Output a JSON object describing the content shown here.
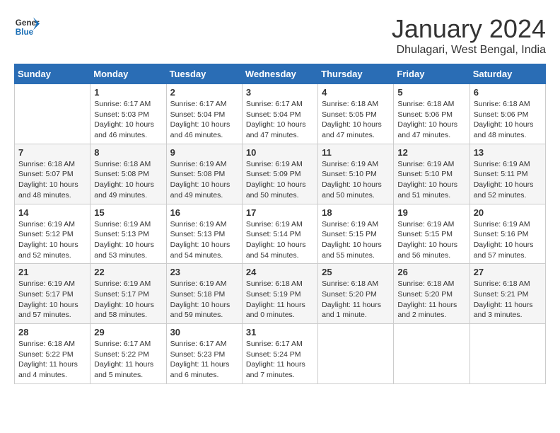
{
  "logo": {
    "line1": "General",
    "line2": "Blue"
  },
  "title": "January 2024",
  "subtitle": "Dhulagari, West Bengal, India",
  "days_of_week": [
    "Sunday",
    "Monday",
    "Tuesday",
    "Wednesday",
    "Thursday",
    "Friday",
    "Saturday"
  ],
  "weeks": [
    [
      {
        "day": "",
        "content": ""
      },
      {
        "day": "1",
        "content": "Sunrise: 6:17 AM\nSunset: 5:03 PM\nDaylight: 10 hours\nand 46 minutes."
      },
      {
        "day": "2",
        "content": "Sunrise: 6:17 AM\nSunset: 5:04 PM\nDaylight: 10 hours\nand 46 minutes."
      },
      {
        "day": "3",
        "content": "Sunrise: 6:17 AM\nSunset: 5:04 PM\nDaylight: 10 hours\nand 47 minutes."
      },
      {
        "day": "4",
        "content": "Sunrise: 6:18 AM\nSunset: 5:05 PM\nDaylight: 10 hours\nand 47 minutes."
      },
      {
        "day": "5",
        "content": "Sunrise: 6:18 AM\nSunset: 5:06 PM\nDaylight: 10 hours\nand 47 minutes."
      },
      {
        "day": "6",
        "content": "Sunrise: 6:18 AM\nSunset: 5:06 PM\nDaylight: 10 hours\nand 48 minutes."
      }
    ],
    [
      {
        "day": "7",
        "content": "Sunrise: 6:18 AM\nSunset: 5:07 PM\nDaylight: 10 hours\nand 48 minutes."
      },
      {
        "day": "8",
        "content": "Sunrise: 6:18 AM\nSunset: 5:08 PM\nDaylight: 10 hours\nand 49 minutes."
      },
      {
        "day": "9",
        "content": "Sunrise: 6:19 AM\nSunset: 5:08 PM\nDaylight: 10 hours\nand 49 minutes."
      },
      {
        "day": "10",
        "content": "Sunrise: 6:19 AM\nSunset: 5:09 PM\nDaylight: 10 hours\nand 50 minutes."
      },
      {
        "day": "11",
        "content": "Sunrise: 6:19 AM\nSunset: 5:10 PM\nDaylight: 10 hours\nand 50 minutes."
      },
      {
        "day": "12",
        "content": "Sunrise: 6:19 AM\nSunset: 5:10 PM\nDaylight: 10 hours\nand 51 minutes."
      },
      {
        "day": "13",
        "content": "Sunrise: 6:19 AM\nSunset: 5:11 PM\nDaylight: 10 hours\nand 52 minutes."
      }
    ],
    [
      {
        "day": "14",
        "content": "Sunrise: 6:19 AM\nSunset: 5:12 PM\nDaylight: 10 hours\nand 52 minutes."
      },
      {
        "day": "15",
        "content": "Sunrise: 6:19 AM\nSunset: 5:13 PM\nDaylight: 10 hours\nand 53 minutes."
      },
      {
        "day": "16",
        "content": "Sunrise: 6:19 AM\nSunset: 5:13 PM\nDaylight: 10 hours\nand 54 minutes."
      },
      {
        "day": "17",
        "content": "Sunrise: 6:19 AM\nSunset: 5:14 PM\nDaylight: 10 hours\nand 54 minutes."
      },
      {
        "day": "18",
        "content": "Sunrise: 6:19 AM\nSunset: 5:15 PM\nDaylight: 10 hours\nand 55 minutes."
      },
      {
        "day": "19",
        "content": "Sunrise: 6:19 AM\nSunset: 5:15 PM\nDaylight: 10 hours\nand 56 minutes."
      },
      {
        "day": "20",
        "content": "Sunrise: 6:19 AM\nSunset: 5:16 PM\nDaylight: 10 hours\nand 57 minutes."
      }
    ],
    [
      {
        "day": "21",
        "content": "Sunrise: 6:19 AM\nSunset: 5:17 PM\nDaylight: 10 hours\nand 57 minutes."
      },
      {
        "day": "22",
        "content": "Sunrise: 6:19 AM\nSunset: 5:17 PM\nDaylight: 10 hours\nand 58 minutes."
      },
      {
        "day": "23",
        "content": "Sunrise: 6:19 AM\nSunset: 5:18 PM\nDaylight: 10 hours\nand 59 minutes."
      },
      {
        "day": "24",
        "content": "Sunrise: 6:18 AM\nSunset: 5:19 PM\nDaylight: 11 hours\nand 0 minutes."
      },
      {
        "day": "25",
        "content": "Sunrise: 6:18 AM\nSunset: 5:20 PM\nDaylight: 11 hours\nand 1 minute."
      },
      {
        "day": "26",
        "content": "Sunrise: 6:18 AM\nSunset: 5:20 PM\nDaylight: 11 hours\nand 2 minutes."
      },
      {
        "day": "27",
        "content": "Sunrise: 6:18 AM\nSunset: 5:21 PM\nDaylight: 11 hours\nand 3 minutes."
      }
    ],
    [
      {
        "day": "28",
        "content": "Sunrise: 6:18 AM\nSunset: 5:22 PM\nDaylight: 11 hours\nand 4 minutes."
      },
      {
        "day": "29",
        "content": "Sunrise: 6:17 AM\nSunset: 5:22 PM\nDaylight: 11 hours\nand 5 minutes."
      },
      {
        "day": "30",
        "content": "Sunrise: 6:17 AM\nSunset: 5:23 PM\nDaylight: 11 hours\nand 6 minutes."
      },
      {
        "day": "31",
        "content": "Sunrise: 6:17 AM\nSunset: 5:24 PM\nDaylight: 11 hours\nand 7 minutes."
      },
      {
        "day": "",
        "content": ""
      },
      {
        "day": "",
        "content": ""
      },
      {
        "day": "",
        "content": ""
      }
    ]
  ]
}
